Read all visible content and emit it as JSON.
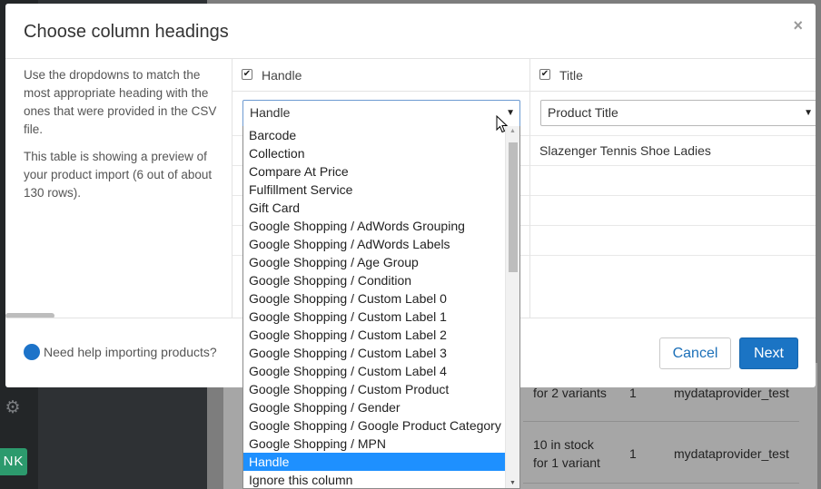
{
  "modal": {
    "title": "Choose column headings",
    "close_icon": "×"
  },
  "help": {
    "paragraph1": "Use the dropdowns to match the most appropriate heading with the ones that were provided in the CSV file.",
    "paragraph2": "This table is showing a preview of your product import (6 out of about 130 rows)."
  },
  "columns": [
    {
      "label": "Handle",
      "checked": true,
      "selected": "Handle",
      "cells": [
        "",
        "",
        "",
        "",
        ""
      ]
    },
    {
      "label": "Title",
      "checked": true,
      "selected": "Product Title",
      "cells": [
        "Slazenger Tennis Shoe Ladies",
        "",
        "",
        "",
        ""
      ]
    }
  ],
  "dropdown": {
    "options": [
      "Barcode",
      "Collection",
      "Compare At Price",
      "Fulfillment Service",
      "Gift Card",
      "Google Shopping / AdWords Grouping",
      "Google Shopping / AdWords Labels",
      "Google Shopping / Age Group",
      "Google Shopping / Condition",
      "Google Shopping / Custom Label 0",
      "Google Shopping / Custom Label 1",
      "Google Shopping / Custom Label 2",
      "Google Shopping / Custom Label 3",
      "Google Shopping / Custom Label 4",
      "Google Shopping / Custom Product",
      "Google Shopping / Gender",
      "Google Shopping / Google Product Category",
      "Google Shopping / MPN",
      "Handle",
      "Ignore this column"
    ],
    "selected_index": 18
  },
  "footer": {
    "help_link": "Need help importing products?",
    "cancel_label": "Cancel",
    "next_label": "Next"
  },
  "background": {
    "avatar_initials": "NK",
    "rows": [
      {
        "stock": "for 2 variants",
        "count": "1",
        "provider": "mydataprovider_test"
      },
      {
        "stock_line1": "10 in stock",
        "stock_line2": "for 1 variant",
        "count": "1",
        "provider": "mydataprovider_test"
      }
    ]
  },
  "colors": {
    "primary": "#1b74c4",
    "link": "#1b6fb8",
    "selected_option": "#1e90ff",
    "avatar": "#2c9a6d"
  }
}
